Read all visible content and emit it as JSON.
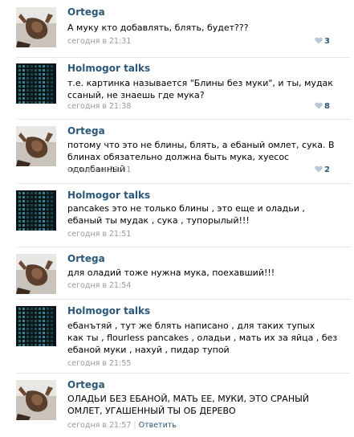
{
  "comments": [
    {
      "author": "Ortega",
      "avatar": "ortega",
      "lines": [
        "А муку кто добавлять, блять, будет???"
      ],
      "time": "сегодня в 21:31",
      "likes": "3"
    },
    {
      "author": "Holmogor talks",
      "avatar": "matrix",
      "lines": [
        "т.е. картинка называется \"Блины без муки\", и ты, мудак",
        "ссаный, не знаешь где мука?"
      ],
      "time": "сегодня в 21:38",
      "likes": "8"
    },
    {
      "author": "Ortega",
      "avatar": "ortega",
      "lines": [
        "потому что это не блины, блять, а ебаный омлет, сука. В",
        "блинах обязательно должна быть мука, хуесос одолбанный"
      ],
      "time": "сегодня в 21:41",
      "likes": "2"
    },
    {
      "author": "Holmogor talks",
      "avatar": "matrix",
      "lines": [
        "pancakes это не только блины , это еще и оладьи ,",
        "ебаный ты мудак , сука , тупорылый!!!"
      ],
      "time": "сегодня в 21:51",
      "likes": ""
    },
    {
      "author": "Ortega",
      "avatar": "ortega",
      "lines": [
        "для оладий тоже нужна мука, поехавший!!!"
      ],
      "time": "сегодня в 21:54",
      "likes": ""
    },
    {
      "author": "Holmogor talks",
      "avatar": "matrix",
      "lines": [
        "ебанътяй , тут же блять написано , для таких тупых",
        "как ты , flourless pancakes , оладьи , мать их за яйца , без",
        "ебаной муки , нахуй , пидар тупой"
      ],
      "time": "сегодня в 21:55",
      "likes": ""
    },
    {
      "author": "Ortega",
      "avatar": "ortega",
      "lines": [
        "ОЛАДЬИ БЕЗ ЕБАНОЙ, МАТЬ ЕЕ, МУКИ, ЭТО СРАНЫЙ",
        "ОМЛЕТ, УГАШЕННЫЙ ТЫ ОБ ДЕРЕВО"
      ],
      "time": "сегодня в 21:57",
      "likes": "",
      "reply": "Ответить"
    }
  ],
  "colors": {
    "link": "#2b587a",
    "meta": "#999999",
    "separator": "#e6e9ee"
  }
}
